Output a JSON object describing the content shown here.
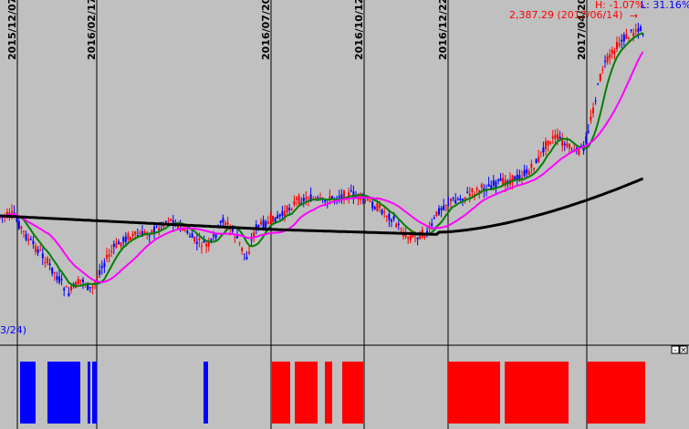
{
  "chart_data": {
    "type": "candlestick",
    "x_date_labels": [
      "2015/12/07",
      "2016/02/17",
      "2016/07/20",
      "2016/10/12",
      "2016/12/22",
      "2017/04/20"
    ],
    "low_annotation": "3/24)",
    "high_annotation": "2,387.29 (2017/06/14)",
    "high_pct_label": "H: -1.07%",
    "low_pct_label": "L: 31.16%",
    "price_series_approx": [
      {
        "x": "2015/12",
        "close": 2000
      },
      {
        "x": "2016/02/17",
        "close": 1860
      },
      {
        "x": "2016/04",
        "close": 1990
      },
      {
        "x": "2016/07/20",
        "close": 2010
      },
      {
        "x": "2016/10/12",
        "close": 2040
      },
      {
        "x": "2016/12/22",
        "close": 2010
      },
      {
        "x": "2017/02",
        "close": 2080
      },
      {
        "x": "2017/04/20",
        "close": 2170
      },
      {
        "x": "2017/06/14",
        "close": 2387.29
      }
    ],
    "moving_averages": [
      {
        "color": "#008000"
      },
      {
        "color": "#ff00ff"
      },
      {
        "color": "#000000"
      }
    ],
    "colors": {
      "up": "#ff0000",
      "down": "#0000ff",
      "background": "#c0c0c0",
      "vline": "#000000"
    },
    "signal_panel": {
      "blocks": [
        {
          "start": "2015/12",
          "end": "2016/01",
          "signal": "sell"
        },
        {
          "start": "2016/01",
          "end": "2016/02",
          "signal": "sell"
        },
        {
          "start": "2016/02",
          "end": "2016/02",
          "signal": "sell"
        },
        {
          "start": "2016/02/17",
          "end": "2016/02/24",
          "signal": "sell"
        },
        {
          "start": "2016/06",
          "end": "2016/06",
          "signal": "sell"
        },
        {
          "start": "2016/07/20",
          "end": "2016/08",
          "signal": "buy"
        },
        {
          "start": "2016/08",
          "end": "2016/09",
          "signal": "buy"
        },
        {
          "start": "2016/09",
          "end": "2016/09",
          "signal": "buy"
        },
        {
          "start": "2016/09",
          "end": "2016/10/12",
          "signal": "buy"
        },
        {
          "start": "2016/12/22",
          "end": "2017/02",
          "signal": "buy"
        },
        {
          "start": "2017/02",
          "end": "2017/04",
          "signal": "buy"
        },
        {
          "start": "2017/04/20",
          "end": "2017/06",
          "signal": "buy"
        }
      ],
      "sell_color": "#0000ff",
      "buy_color": "#ff0000"
    },
    "panel_buttons": [
      "-",
      "×"
    ]
  }
}
